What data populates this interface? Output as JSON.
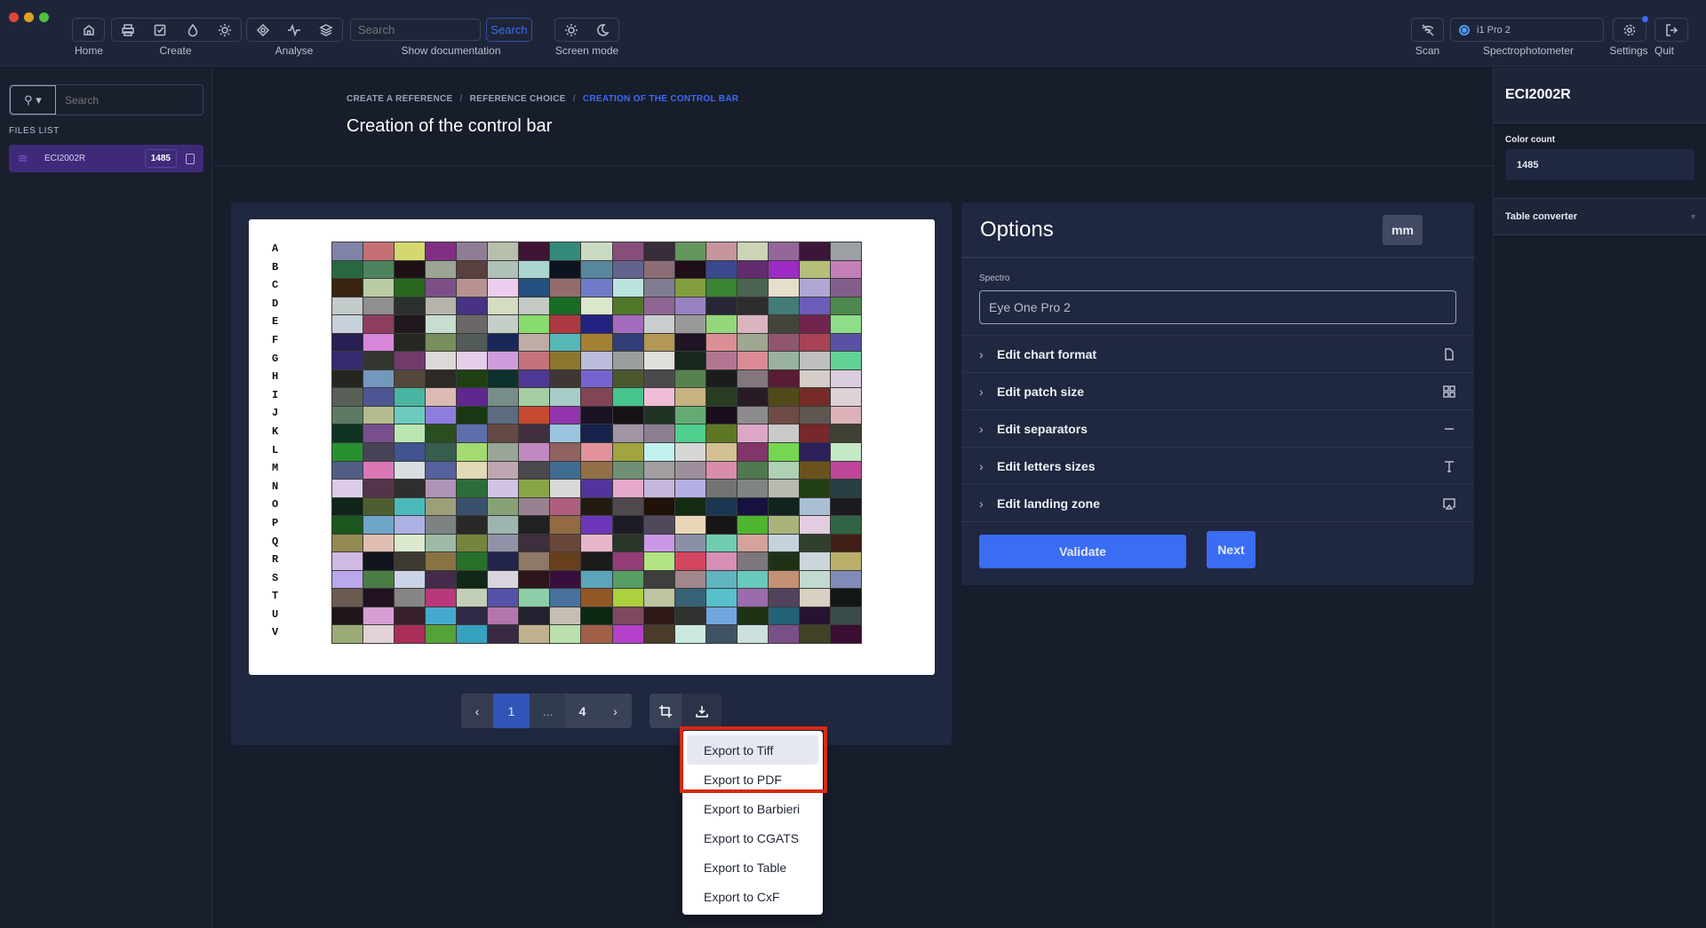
{
  "window_controls": {
    "close": "#e0443e",
    "minimize": "#dea123",
    "maximize": "#4fbf41"
  },
  "toolbar": {
    "home": "Home",
    "create": "Create",
    "analyse": "Analyse",
    "search_placeholder": "Search",
    "search_button": "Search",
    "show_documentation": "Show documentation",
    "screen_mode": "Screen mode",
    "scan": "Scan",
    "device": "i1 Pro 2",
    "spectrophotometer": "Spectrophotometer",
    "settings": "Settings",
    "quit": "Quit"
  },
  "sidebar": {
    "search_placeholder": "Search",
    "files_list": "FILES LIST",
    "files": [
      {
        "name": "ECI2002R",
        "count": "1485"
      }
    ]
  },
  "breadcrumb": [
    "CREATE A REFERENCE",
    "REFERENCE CHOICE",
    "CREATION OF THE CONTROL BAR"
  ],
  "page_title": "Creation of the control bar",
  "chart": {
    "rows": [
      "A",
      "B",
      "C",
      "D",
      "E",
      "F",
      "G",
      "H",
      "I",
      "J",
      "K",
      "L",
      "M",
      "N",
      "O",
      "P",
      "Q",
      "R",
      "S",
      "T",
      "U",
      "V"
    ],
    "columns": 17
  },
  "pagination": {
    "prev": "‹",
    "current": "1",
    "ellipsis": "...",
    "last": "4",
    "next": "›"
  },
  "export_menu": [
    "Export to Tiff",
    "Export to PDF",
    "Export to Barbieri",
    "Export to CGATS",
    "Export to Table",
    "Export to CxF"
  ],
  "options": {
    "title": "Options",
    "unit": "mm",
    "spectro_label": "Spectro",
    "spectro_value": "Eye One Pro 2",
    "sections": [
      {
        "label": "Edit chart format",
        "icon": "file-icon"
      },
      {
        "label": "Edit patch size",
        "icon": "grid-icon"
      },
      {
        "label": "Edit separators",
        "icon": "minus-icon"
      },
      {
        "label": "Edit letters sizes",
        "icon": "text-icon"
      },
      {
        "label": "Edit landing zone",
        "icon": "airplay-icon"
      }
    ],
    "validate": "Validate",
    "next": "Next"
  },
  "right_panel": {
    "title": "ECI2002R",
    "color_count_label": "Color count",
    "color_count": "1485",
    "table_converter": "Table converter"
  },
  "colors": {
    "accent": "#3a6cf4",
    "selected_file": "#3f2a7a",
    "highlight": "#d62a12"
  }
}
